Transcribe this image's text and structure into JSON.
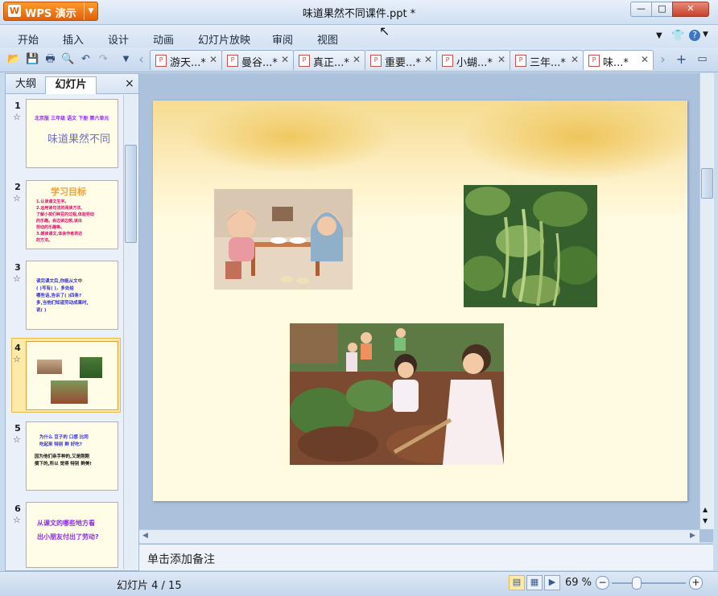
{
  "app": {
    "name": "WPS 演示",
    "logo": "W",
    "window_title": "味道果然不同课件.ppt *"
  },
  "menu": [
    "开始",
    "插入",
    "设计",
    "动画",
    "幻灯片放映",
    "审阅",
    "视图"
  ],
  "doc_tabs": [
    "游天...*",
    "曼谷...*",
    "真正...*",
    "重要...*",
    "小蝴...*",
    "三年...*",
    "味...*"
  ],
  "panel": {
    "tab_outline": "大纲",
    "tab_slides": "幻灯片",
    "close": "×"
  },
  "thumbnails": [
    {
      "num": "1",
      "lines": [
        "北京版 三年级 语文 下册 第六单元",
        "味道果然不同"
      ]
    },
    {
      "num": "2",
      "title": "学习目标",
      "lines": [
        "1.认读课文生字。",
        "2.运用读句法的阅读方法,",
        "了解小孩们种豆的过程,体验劳动",
        "的乐趣。会边读边想,读出",
        "劳动的乐趣等。",
        "3.朗读课文,体会作者表达",
        "的方法。"
      ]
    },
    {
      "num": "3",
      "lines": [
        "读完课文后,你能从文中",
        "(    )写有(    )，多处给",
        "哪些话,告诉了(    )四条?",
        "多,当他们知道劳动成果时,",
        "说(    )"
      ]
    },
    {
      "num": "4"
    },
    {
      "num": "5",
      "lines": [
        "为什么 豆子的 口感 比同",
        "吃起来 特别 鲜 好吃?",
        "因为他们亲手种的,又是刚刚",
        "摘下的,所以 觉得 特别 鲜美!"
      ]
    },
    {
      "num": "6",
      "lines": [
        "从课文的哪些地方看",
        "出小朋友付出了劳动?"
      ]
    }
  ],
  "notes_placeholder": "单击添加备注",
  "status": {
    "slide_count": "幻灯片 4 / 15",
    "zoom": "69 %"
  },
  "colors": {
    "accent": "#e0600a",
    "chrome": "#c9dbef",
    "slide_bg": "#fffbe0"
  }
}
